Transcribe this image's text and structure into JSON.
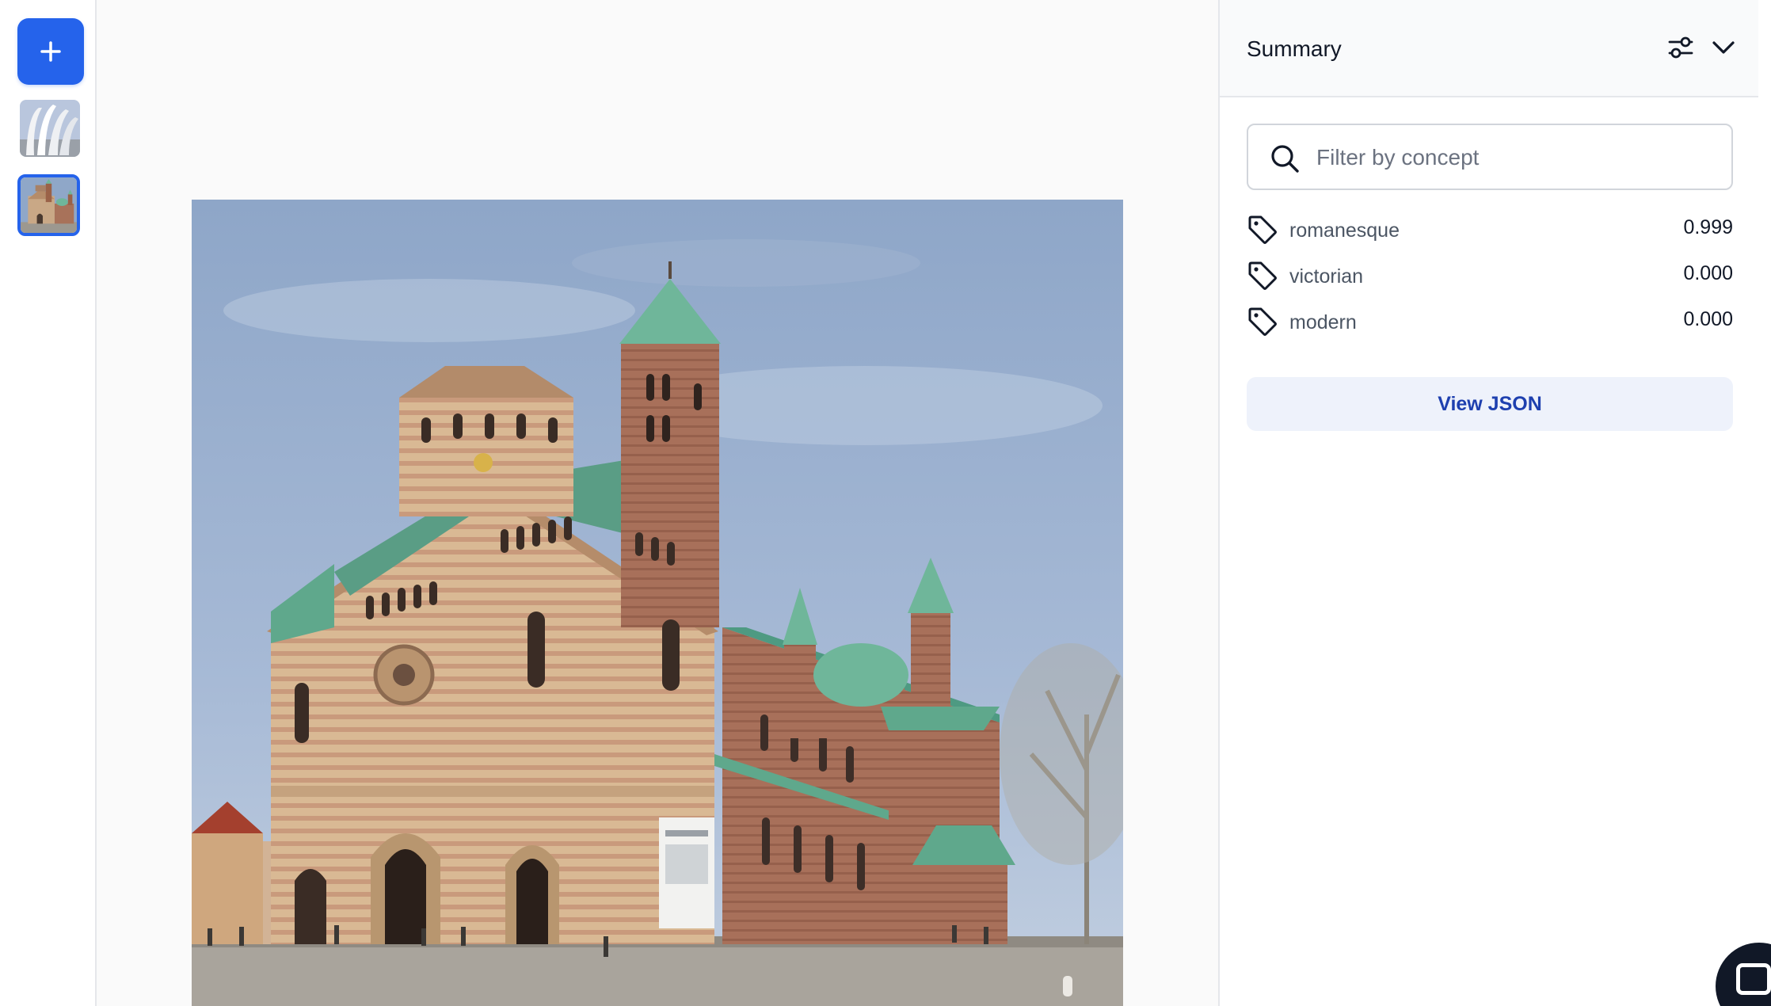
{
  "sidebar": {
    "add_icon": "plus-icon",
    "thumbnails": [
      {
        "name": "image-thumbnail-modern-building",
        "selected": false
      },
      {
        "name": "image-thumbnail-cathedral",
        "selected": true
      }
    ],
    "accent_color": "#2563eb"
  },
  "panel": {
    "title": "Summary",
    "filter_icon": "sliders-icon",
    "collapse_icon": "chevron-down-icon",
    "search": {
      "placeholder": "Filter by concept",
      "value": ""
    },
    "concepts": [
      {
        "label": "romanesque",
        "score": "0.999",
        "icon": "tag-icon"
      },
      {
        "label": "victorian",
        "score": "0.000",
        "icon": "tag-icon"
      },
      {
        "label": "modern",
        "score": "0.000",
        "icon": "tag-icon"
      }
    ],
    "view_json_label": "View JSON"
  },
  "main": {
    "image_subject": "Speyer Cathedral photo"
  }
}
